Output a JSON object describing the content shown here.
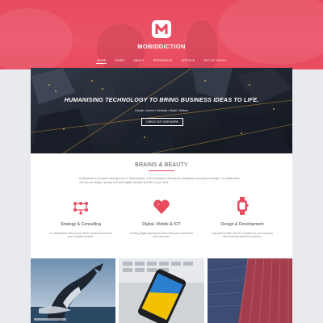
{
  "brand": {
    "name": "MOBIDDICTION",
    "logo_letter": "M",
    "accent_color": "#e84a5f"
  },
  "nav": {
    "items": [
      "HOME",
      "WORK",
      "ABOUT",
      "REFERENCE",
      "ARTICLE",
      "GET IN TOUCH"
    ],
    "active_index": 0
  },
  "hero": {
    "title": "HUMANISING TECHNOLOGY TO BRING BUSINESS IDEAS TO LIFE.",
    "subtitle": "Create • Invent • Develop • Build • Deliver",
    "button_label": "CHECK OUT OUR WORK"
  },
  "section": {
    "title": "BRAINS & BEAUTY",
    "intro": "Mobiddiction is an award winning team of Technologists, UX/UI Designers, developers, strategists and project managers. In collaboration with you we design, develop and build digital solutions specific to your need."
  },
  "services": [
    {
      "icon": "network-icon",
      "name": "Strategy & Consulting",
      "desc": "In collaboration with you we deliver solutions that drive your business forward."
    },
    {
      "icon": "heart-icon",
      "name": "Digital, Mobile & IOT",
      "desc": "Creating digital experiences that enrich your connection with customers."
    },
    {
      "icon": "smartwatch-icon",
      "name": "Design & Development",
      "desc": "Innovative mobile and IOT solutions for your business that scale and adapt for tomorrow."
    }
  ],
  "tiles": [
    {
      "name": "whale-photo"
    },
    {
      "name": "smartphone-photo"
    },
    {
      "name": "building-photo"
    }
  ]
}
